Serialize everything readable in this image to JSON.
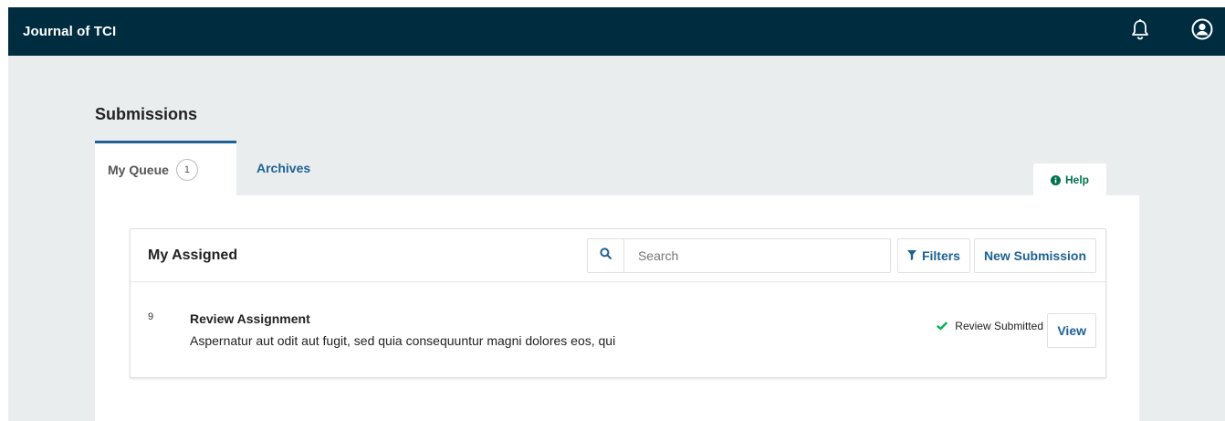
{
  "header": {
    "brand": "Journal of TCI",
    "notifications_icon": "bell-icon",
    "user_icon": "user-circle-icon"
  },
  "page": {
    "title": "Submissions"
  },
  "tabs": [
    {
      "label": "My Queue",
      "count": "1",
      "active": true
    },
    {
      "label": "Archives",
      "active": false
    }
  ],
  "help": {
    "label": "Help",
    "icon": "info-circle-icon"
  },
  "list": {
    "title": "My Assigned",
    "search_placeholder": "Search",
    "search_value": "",
    "filters_label": "Filters",
    "new_submission_label": "New Submission",
    "items": [
      {
        "id": "9",
        "title": "Review Assignment",
        "subtitle": "Aspernatur aut odit aut fugit, sed quia consequuntur magni dolores eos, qui",
        "status": "Review Submitted",
        "action": "View"
      }
    ]
  },
  "colors": {
    "topbar": "#002c40",
    "link": "#1e6292",
    "help": "#00724b",
    "success": "#00b24e",
    "canvas": "#eaedee"
  }
}
